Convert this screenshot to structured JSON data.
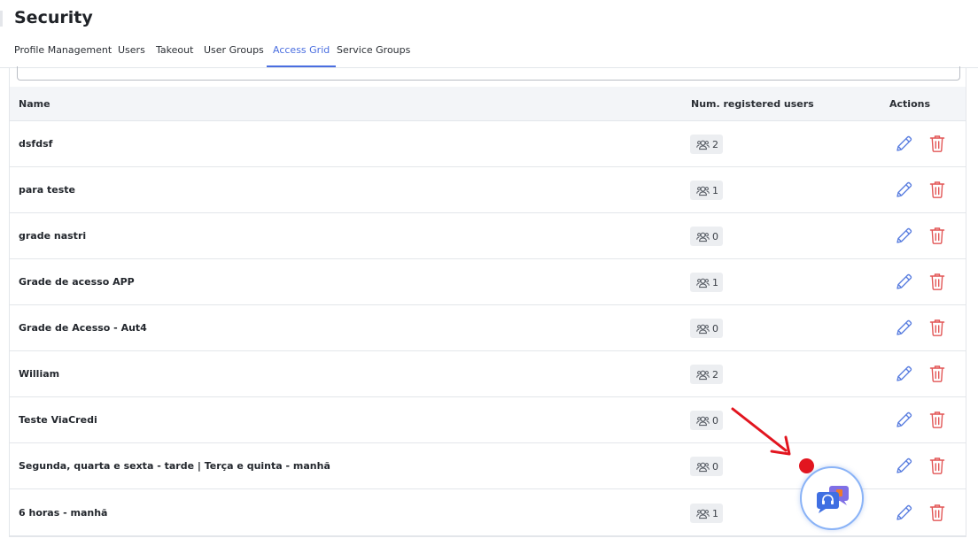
{
  "page": {
    "title": "Security"
  },
  "tabs": [
    {
      "label": "Profile Management",
      "active": false
    },
    {
      "label": "Users",
      "active": false
    },
    {
      "label": "Takeout",
      "active": false
    },
    {
      "label": "User Groups",
      "active": false
    },
    {
      "label": "Access Grid",
      "active": true
    },
    {
      "label": "Service Groups",
      "active": false
    }
  ],
  "table": {
    "headers": {
      "name": "Name",
      "users": "Num. registered users",
      "actions": "Actions"
    },
    "rows": [
      {
        "name": "dsfdsf",
        "users": "2"
      },
      {
        "name": "para teste",
        "users": "1"
      },
      {
        "name": "grade nastri",
        "users": "0"
      },
      {
        "name": "Grade de acesso APP",
        "users": "1"
      },
      {
        "name": "Grade de Acesso - Aut4",
        "users": "0"
      },
      {
        "name": "William",
        "users": "2"
      },
      {
        "name": "Teste ViaCredi",
        "users": "0"
      },
      {
        "name": "Segunda, quarta e sexta - tarde | Terça e quinta - manhã",
        "users": "0"
      },
      {
        "name": "6 horas - manhã",
        "users": "1"
      }
    ]
  },
  "icons": {
    "users": "users-group-icon",
    "edit": "pencil-icon",
    "delete": "trash-icon",
    "chat": "chat-support-icon"
  },
  "colors": {
    "accent": "#4a6ee0",
    "edit": "#5b7fe0",
    "delete": "#e25555",
    "notification": "#e2151f",
    "annotation_arrow": "#e2151f"
  }
}
